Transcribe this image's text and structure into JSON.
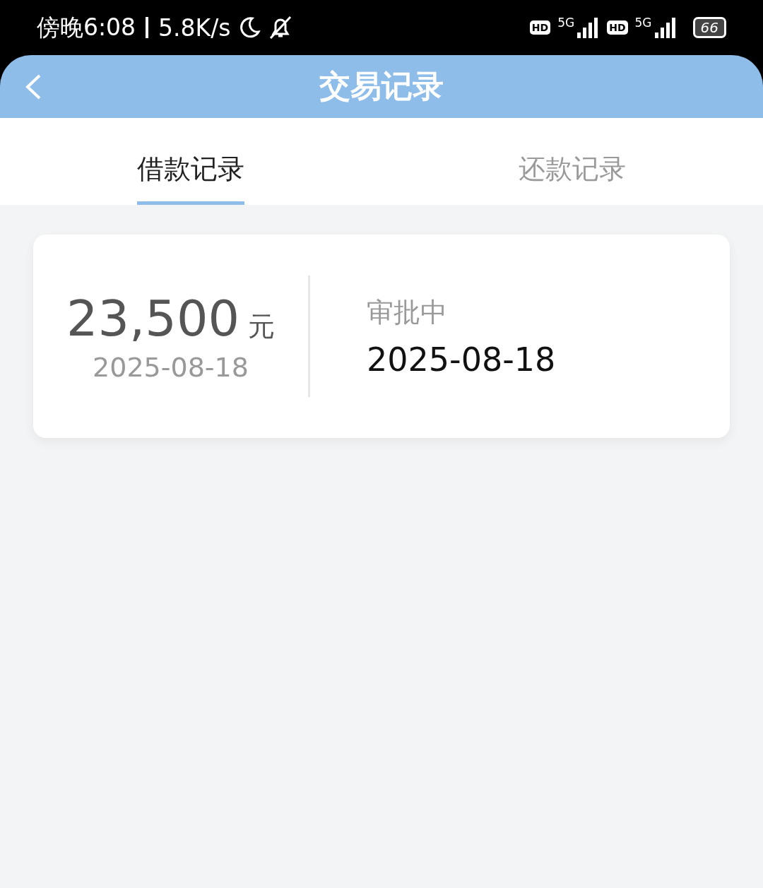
{
  "status_bar": {
    "time": "傍晚6:08",
    "speed": "5.8K/s",
    "sims": [
      {
        "hd": "HD",
        "network": "5G"
      },
      {
        "hd": "HD",
        "network": "5G"
      }
    ],
    "battery": "66"
  },
  "header": {
    "title": "交易记录"
  },
  "tabs": [
    {
      "label": "借款记录",
      "selected": true
    },
    {
      "label": "还款记录",
      "selected": false
    }
  ],
  "records": [
    {
      "amount": "23,500",
      "unit": "元",
      "date": "2025-08-18",
      "status": "审批中",
      "status_date": "2025-08-18"
    }
  ]
}
